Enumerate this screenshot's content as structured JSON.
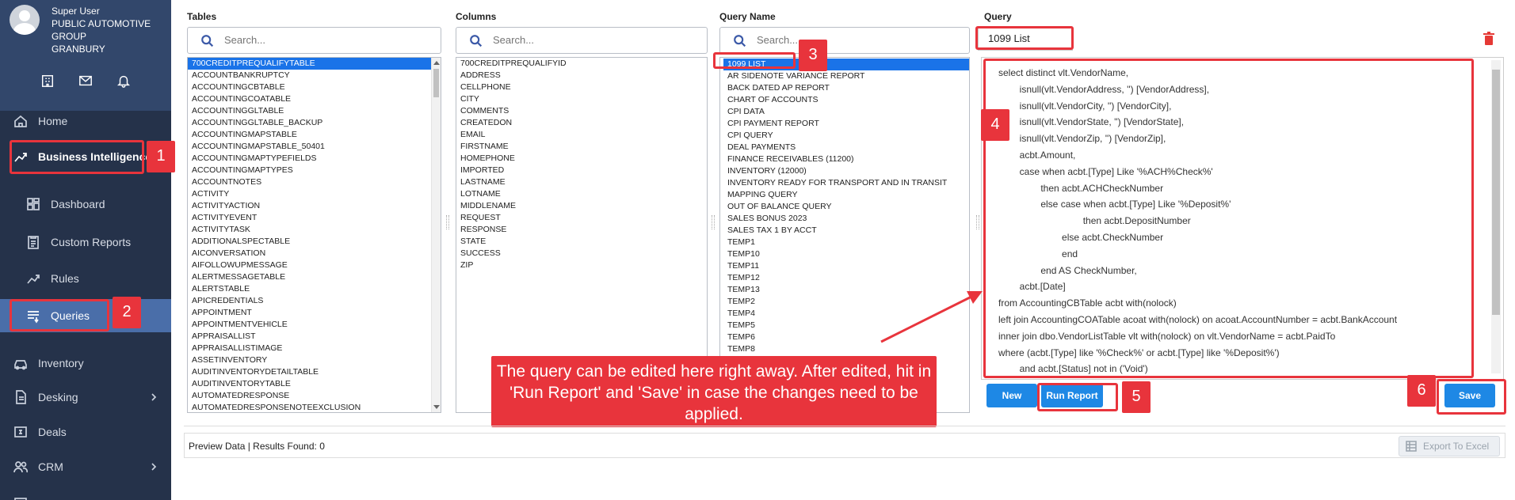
{
  "user": {
    "line1": "Super User",
    "line2": "PUBLIC AUTOMOTIVE",
    "line3": "GROUP",
    "line4": "GRANBURY"
  },
  "nav": {
    "home": "Home",
    "business_intelligence": "Business Intelligence",
    "dashboard": "Dashboard",
    "custom_reports": "Custom Reports",
    "rules": "Rules",
    "queries": "Queries",
    "inventory": "Inventory",
    "desking": "Desking",
    "deals": "Deals",
    "crm": "CRM"
  },
  "panels": {
    "tables": "Tables",
    "columns": "Columns",
    "query_name": "Query Name",
    "query": "Query",
    "search_placeholder": "Search..."
  },
  "tables": [
    "700CREDITPREQUALIFYTABLE",
    "ACCOUNTBANKRUPTCY",
    "ACCOUNTINGCBTABLE",
    "ACCOUNTINGCOATABLE",
    "ACCOUNTINGGLTABLE",
    "ACCOUNTINGGLTABLE_BACKUP",
    "ACCOUNTINGMAPSTABLE",
    "ACCOUNTINGMAPSTABLE_50401",
    "ACCOUNTINGMAPTYPEFIELDS",
    "ACCOUNTINGMAPTYPES",
    "ACCOUNTNOTES",
    "ACTIVITY",
    "ACTIVITYACTION",
    "ACTIVITYEVENT",
    "ACTIVITYTASK",
    "ADDITIONALSPECTABLE",
    "AICONVERSATION",
    "AIFOLLOWUPMESSAGE",
    "ALERTMESSAGETABLE",
    "ALERTSTABLE",
    "APICREDENTIALS",
    "APPOINTMENT",
    "APPOINTMENTVEHICLE",
    "APPRAISALLIST",
    "APPRAISALLISTIMAGE",
    "ASSETINVENTORY",
    "AUDITINVENTORYDETAILTABLE",
    "AUDITINVENTORYTABLE",
    "AUTOMATEDRESPONSE",
    "AUTOMATEDRESPONSENOTEEXCLUSION"
  ],
  "columns": [
    "700CREDITPREQUALIFYID",
    "ADDRESS",
    "CELLPHONE",
    "CITY",
    "COMMENTS",
    "CREATEDON",
    "EMAIL",
    "FIRSTNAME",
    "HOMEPHONE",
    "IMPORTED",
    "LASTNAME",
    "LOTNAME",
    "MIDDLENAME",
    "REQUEST",
    "RESPONSE",
    "STATE",
    "SUCCESS",
    "ZIP"
  ],
  "query_names": [
    "1099 LIST",
    "AR SIDENOTE VARIANCE REPORT",
    "BACK DATED AP REPORT",
    "CHART OF ACCOUNTS",
    "CPI DATA",
    "CPI PAYMENT REPORT",
    "CPI QUERY",
    "DEAL PAYMENTS",
    "FINANCE RECEIVABLES (11200)",
    "INVENTORY (12000)",
    "INVENTORY READY FOR TRANSPORT AND IN TRANSIT",
    "MAPPING QUERY",
    "OUT OF BALANCE QUERY",
    "SALES BONUS 2023",
    "SALES TAX 1 BY ACCT",
    "TEMP1",
    "TEMP10",
    "TEMP11",
    "TEMP12",
    "TEMP13",
    "TEMP2",
    "TEMP4",
    "TEMP5",
    "TEMP6",
    "TEMP8"
  ],
  "query": {
    "name_value": "1099 List",
    "sql": "select distinct vlt.VendorName,\n        isnull(vlt.VendorAddress, '') [VendorAddress],\n        isnull(vlt.VendorCity, '') [VendorCity],\n        isnull(vlt.VendorState, '') [VendorState],\n        isnull(vlt.VendorZip, '') [VendorZip],\n        acbt.Amount,\n        case when acbt.[Type] Like '%ACH%Check%'\n                then acbt.ACHCheckNumber\n                else case when acbt.[Type] Like '%Deposit%'\n                                then acbt.DepositNumber\n                        else acbt.CheckNumber\n                        end\n                end AS CheckNumber,\n        acbt.[Date]\nfrom AccountingCBTable acbt with(nolock)\nleft join AccountingCOATable acoat with(nolock) on acoat.AccountNumber = acbt.BankAccount\ninner join dbo.VendorListTable vlt with(nolock) on vlt.VendorName = acbt.PaidTo\nwhere (acbt.[Type] like '%Check%' or acbt.[Type] like '%Deposit%')\n        and acbt.[Status] not in ('Void')"
  },
  "buttons": {
    "new": "New",
    "run_report": "Run Report",
    "save": "Save",
    "export": "Export To Excel"
  },
  "preview": {
    "label": "Preview Data | Results Found: 0"
  },
  "annotation": {
    "text": "The query can be edited here right away. After edited, hit in 'Run Report' and 'Save' in case the changes need to be applied."
  },
  "markers": {
    "m1": "1",
    "m2": "2",
    "m3": "3",
    "m4": "4",
    "m5": "5",
    "m6": "6"
  },
  "colors": {
    "sidebar": "#25324a",
    "active": "#4a6ea9",
    "accent": "#1e88e5",
    "callout": "#e8343c"
  }
}
